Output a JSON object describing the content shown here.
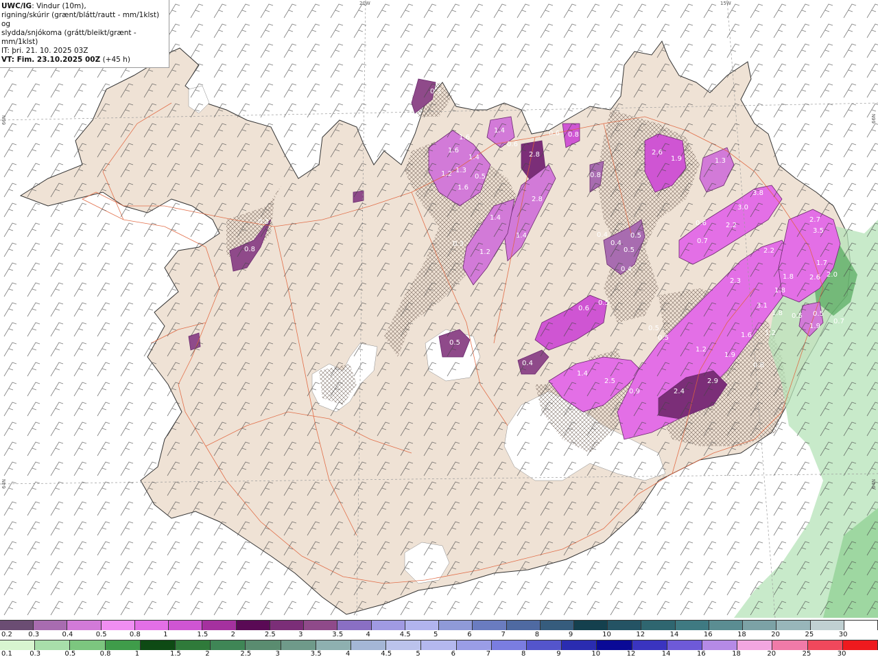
{
  "header": {
    "line1_bold": "UWC/IG",
    "line1_rest": ": Vindur (10m),",
    "line2": "rigning/skúrir (grænt/blátt/rautt - mm/1klst) og",
    "line3": "slydda/snjókoma (grátt/bleikt/grænt - mm/1klst)",
    "line4": "IT: þri. 21. 10. 2025 03Z",
    "line5_bold": "VT: Fim. 23.10.2025 00Z",
    "line5_rest": " (+45 h)"
  },
  "grid_labels": {
    "lon_20w": "20W",
    "lon_15w": "15W",
    "lat_66n_left": "66N",
    "lat_66n_right": "66N",
    "lat_64n_left": "64N",
    "lat_64n_right": "64N"
  },
  "precip_values": [
    "0.3",
    "1.6",
    "1.4",
    "1.6",
    "1.4",
    "1.2",
    "1.3",
    "0.5",
    "1.6",
    "0.6",
    "2.8",
    "0.6",
    "0.8",
    "2.6",
    "1.9",
    "1.3",
    "2.8",
    "1.4",
    "1.4",
    "1.2",
    "0.8",
    "0.3",
    "0.4",
    "0.4",
    "0.5",
    "0.5",
    "0.4",
    "0.6",
    "3.8",
    "3.0",
    "2.2",
    "0.7",
    "2.2",
    "2.7",
    "3.5",
    "1.7",
    "2.6",
    "2.0",
    "2.3",
    "1.8",
    "1.8",
    "3.1",
    "1.8",
    "0.5",
    "1.2",
    "1.6",
    "0.5",
    "0.7",
    "1.9",
    "0.5",
    "0.6",
    "0.5",
    "0.5",
    "0.5",
    "0.4",
    "1.4",
    "2.5",
    "0.9",
    "2.4",
    "2.9",
    "1.9",
    "1.2",
    "0.8",
    "0.3",
    "0.8"
  ],
  "snow_scale": {
    "labels": [
      "0.2",
      "0.3",
      "0.4",
      "0.5",
      "0.8",
      "1",
      "1.5",
      "2",
      "2.5",
      "3",
      "3.5",
      "4",
      "4.5",
      "5",
      "6",
      "7",
      "8",
      "9",
      "10",
      "12",
      "14",
      "16",
      "18",
      "20",
      "25",
      "30"
    ],
    "colors": [
      "#6b4d73",
      "#a86cb0",
      "#d27ad8",
      "#f08ef2",
      "#e36fe6",
      "#cf55d3",
      "#a5319f",
      "#5a0a55",
      "#7b2e78",
      "#8f4a8a",
      "#8a6fc4",
      "#a09ae2",
      "#b1b4ee",
      "#8f9ad8",
      "#6a7cc0",
      "#4f6aa2",
      "#365c7d",
      "#14404e",
      "#245364",
      "#2f6670",
      "#3f7a82",
      "#5b8d92",
      "#7ca2a6",
      "#98b6ba",
      "#c0d0d2",
      "#ffffff"
    ]
  },
  "rain_scale": {
    "labels": [
      "0.1",
      "0.3",
      "0.5",
      "0.8",
      "1",
      "1.5",
      "2",
      "2.5",
      "3",
      "3.5",
      "4",
      "4.5",
      "5",
      "6",
      "7",
      "8",
      "9",
      "10",
      "12",
      "14",
      "16",
      "18",
      "20",
      "25",
      "30"
    ],
    "colors": [
      "#d8f5d0",
      "#a8deaa",
      "#7cc67f",
      "#3f9c4a",
      "#0e4a14",
      "#2f7a3a",
      "#3f8656",
      "#5a8c70",
      "#6f9a8a",
      "#8eb0b0",
      "#a4b6d6",
      "#bbc3ec",
      "#b4b8ee",
      "#9a9de6",
      "#7a7de0",
      "#5455cc",
      "#2a2cb0",
      "#0a0a96",
      "#3a34c0",
      "#6e5ad8",
      "#b58ae6",
      "#f2a6e0",
      "#f07aa8",
      "#f0485c",
      "#ee1a1e"
    ]
  }
}
